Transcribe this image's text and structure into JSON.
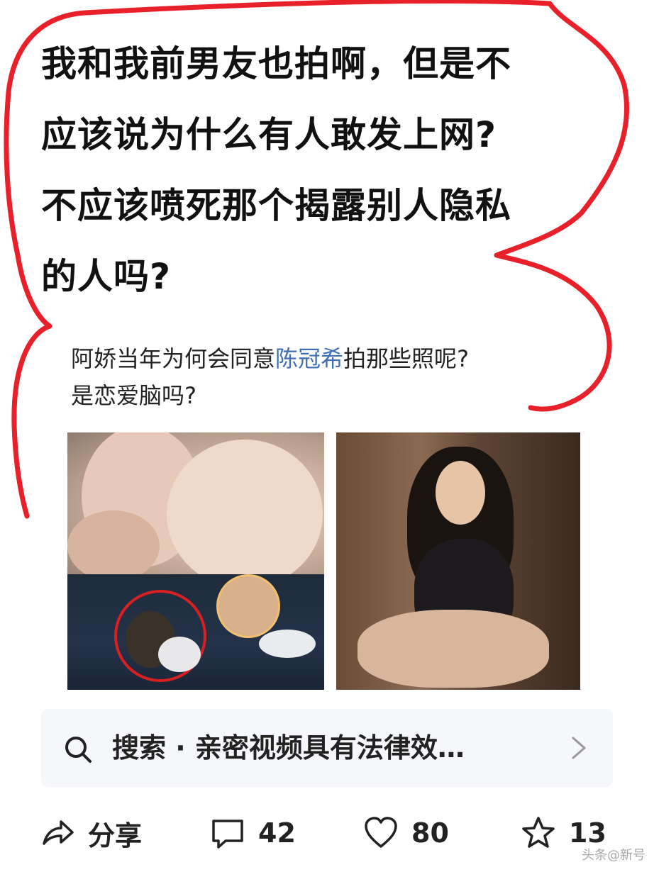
{
  "comment": {
    "lines": [
      "我和我前男友也拍啊，但是不",
      "应该说为什么有人敢发上网?",
      "不应该喷死那个揭露别人隐私",
      "的人吗?"
    ]
  },
  "question": {
    "line1_before": "阿娇当年为何会同意",
    "line1_link": "陈冠希",
    "line1_after": "拍那些照呢?",
    "line2": "是恋爱脑吗?"
  },
  "search": {
    "text": "搜索 · 亲密视频具有法律效…"
  },
  "actions": {
    "share_label": "分享",
    "comment_count": "42",
    "like_count": "80",
    "favorite_count": "13"
  },
  "watermark": "头条@新号",
  "colors": {
    "annotation_red": "#e8202a",
    "link_blue": "#3f6fb1",
    "search_bg": "#f5f7fa"
  }
}
